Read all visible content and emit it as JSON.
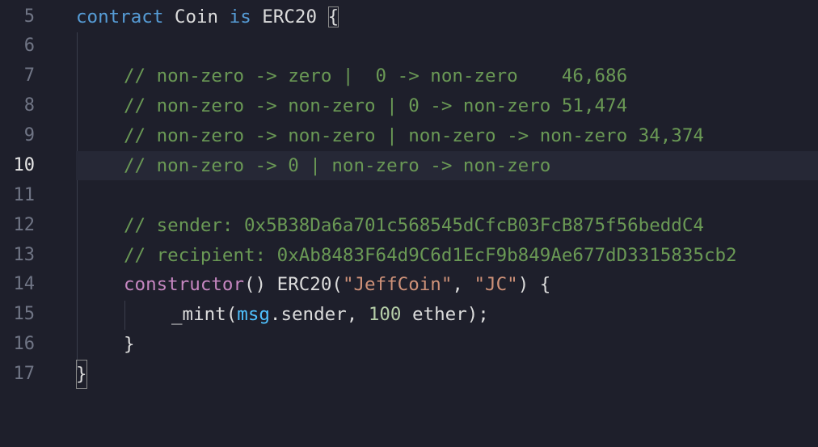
{
  "gutter": {
    "line_numbers": [
      "5",
      "6",
      "7",
      "8",
      "9",
      "10",
      "11",
      "12",
      "13",
      "14",
      "15",
      "16",
      "17"
    ],
    "active_line": "10"
  },
  "code": {
    "l5": {
      "kw_contract": "contract",
      "name": " Coin ",
      "kw_is": "is",
      "base": " ERC20 ",
      "brace": "{"
    },
    "l7": {
      "comment": "// non-zero -> zero |  0 -> non-zero    46,686"
    },
    "l8": {
      "comment": "// non-zero -> non-zero | 0 -> non-zero 51,474"
    },
    "l9": {
      "comment": "// non-zero -> non-zero | non-zero -> non-zero 34,374"
    },
    "l10": {
      "comment": "// non-zero -> 0 | non-zero -> non-zero"
    },
    "l12": {
      "comment": "// sender: 0x5B38Da6a701c568545dCfcB03FcB875f56beddC4"
    },
    "l13": {
      "comment": "// recipient: 0xAb8483F64d9C6d1EcF9b849Ae677dD3315835cb2"
    },
    "l14": {
      "ctor": "constructor",
      "p1": "() ERC20(",
      "s1": "\"JeffCoin\"",
      "p2": ", ",
      "s2": "\"JC\"",
      "p3": ") {"
    },
    "l15": {
      "fn": "_mint(",
      "glob": "msg",
      "p1": ".sender, ",
      "num": "100",
      "p2": " ether);"
    },
    "l16": {
      "brace": "}"
    },
    "l17": {
      "brace": "}"
    }
  },
  "colors": {
    "background": "#1e1f2b",
    "keyword": "#569cd6",
    "comment": "#6a9955",
    "constructor": "#c586c0",
    "string": "#ce9178",
    "number": "#b5cea8",
    "global": "#4fc1ff"
  }
}
